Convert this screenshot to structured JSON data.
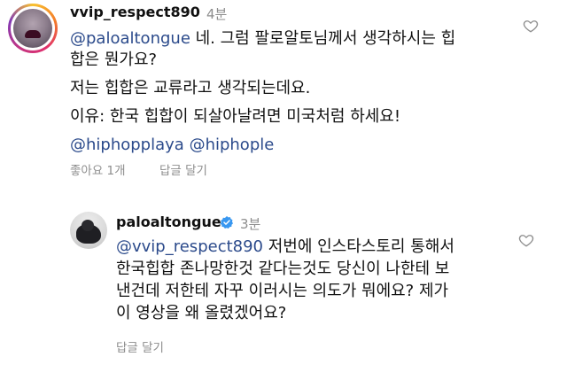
{
  "comment1": {
    "username": "vvip_respect890",
    "time": "4분",
    "mention": "@paloaltongue",
    "line1_rest": " 네. 그럼 팔로알토님께서 생각하시는 힙",
    "line2": "합은 뭔가요?",
    "line3": "저는 힙합은 교류라고 생각되는데요.",
    "line4": "이유: 한국 힙합이 되살아날려면 미국처럼 하세요!",
    "tag1": "@hiphopplaya",
    "tag2": "@hiphople",
    "likes": "좋아요 1개",
    "reply": "답글 달기"
  },
  "comment2": {
    "username": "paloaltongue",
    "time": "3분",
    "mention": "@vvip_respect890",
    "line1_rest": " 저번에 인스타스토리 통해서",
    "line2": "한국힙합 존나망한것 같다는것도 당신이 나한테 보",
    "line3": "낸건데 저한테 자꾸 이러시는 의도가 뭐에요? 제가",
    "line4": "이 영상을 왜 올렸겠어요?",
    "reply": "답글 달기"
  },
  "icons": {
    "heart": "heart-outline-icon",
    "verified": "verified-badge-icon"
  },
  "colors": {
    "mention": "#2b4a8b",
    "secondary_text": "#8e8e8e",
    "verified": "#3897f0"
  }
}
